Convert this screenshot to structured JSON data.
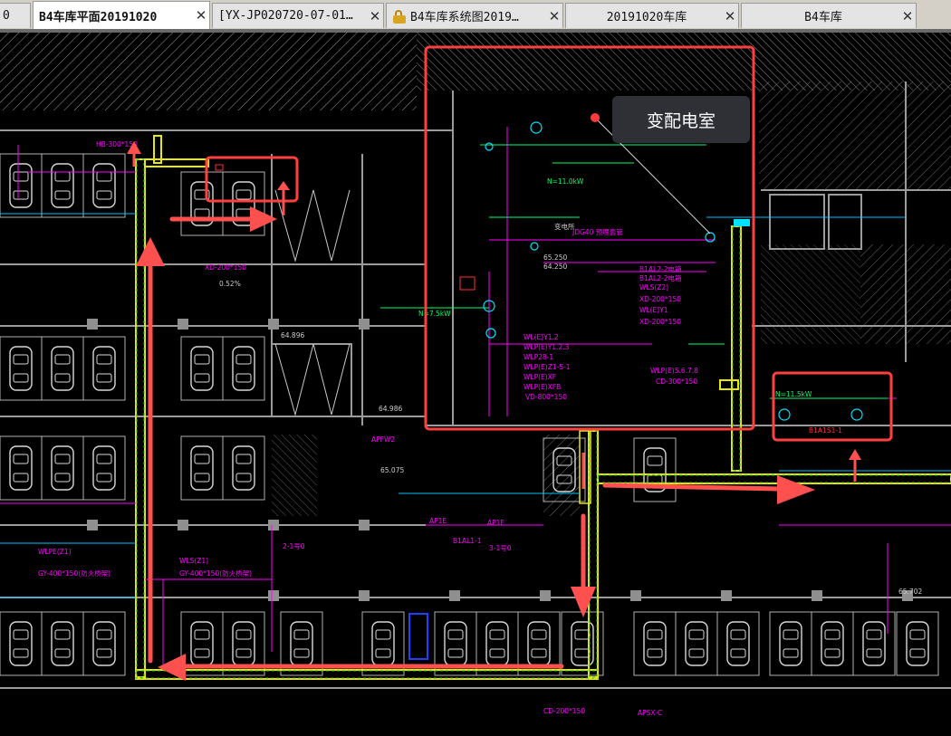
{
  "tabs": [
    {
      "label": "0",
      "active": false
    },
    {
      "label": "B4车库平面20191020",
      "active": true
    },
    {
      "label": "[YX-JP020720-07-01…",
      "active": false
    },
    {
      "label": "B4车库系统图2019…",
      "active": false,
      "locked": true
    },
    {
      "label": "20191020车库",
      "active": false
    },
    {
      "label": "B4车库",
      "active": false
    }
  ],
  "tab_close_glyph": "✕",
  "callout": {
    "label": "变配电室"
  },
  "cad_labels": {
    "room_power": "N=11.0kW",
    "room_power2": "N=7.5kW",
    "jdg": "JDG40 预埋套管",
    "bianya": "变电所",
    "elev1": "65.250",
    "elev2": "64.250",
    "panel_b1": "B1AL2-2电箱",
    "panel_b2": "B1AL2-2电箱",
    "w1": "WLS(Z2)",
    "w2": "XD-200*150",
    "w3": "WL(E)Y1",
    "w4": "XD-200*150",
    "w5": "WL(E)Y1.2",
    "w6": "WLP(E)Y1.2.3",
    "w7": "WLP28-1",
    "w8": "WLP(E)Z1-5-1",
    "w9": "WLP(E)XF",
    "w10": "WLP(E)XFB",
    "w11": "VD-800*150",
    "w12": "WLP(E)5.6.7.8",
    "w13": "CD-300*150",
    "apfw2": "APFW2",
    "ap1e": "AP1E",
    "ap1e2": "AP1E",
    "elev3": "65.075",
    "elev4": "64.986",
    "elev5": "64.896",
    "elev6": "65.702",
    "slope": "0.52%",
    "hb": "HB-300*150",
    "xd": "XD-200*150",
    "wl1": "WLPE(Z1)",
    "wl2": "WLS(Z1)",
    "b1al": "B1AL1-1",
    "gy": "GY-400*150(防火桥架)",
    "gy2": "GY-400*150(防火桥架)",
    "sys1": "3-1号0",
    "sys2": "2-1号0",
    "cd": "CD-200*150",
    "apsx": "APSX-C",
    "b1as": "B1A1S1-1",
    "fan": "N=11.5kW"
  }
}
